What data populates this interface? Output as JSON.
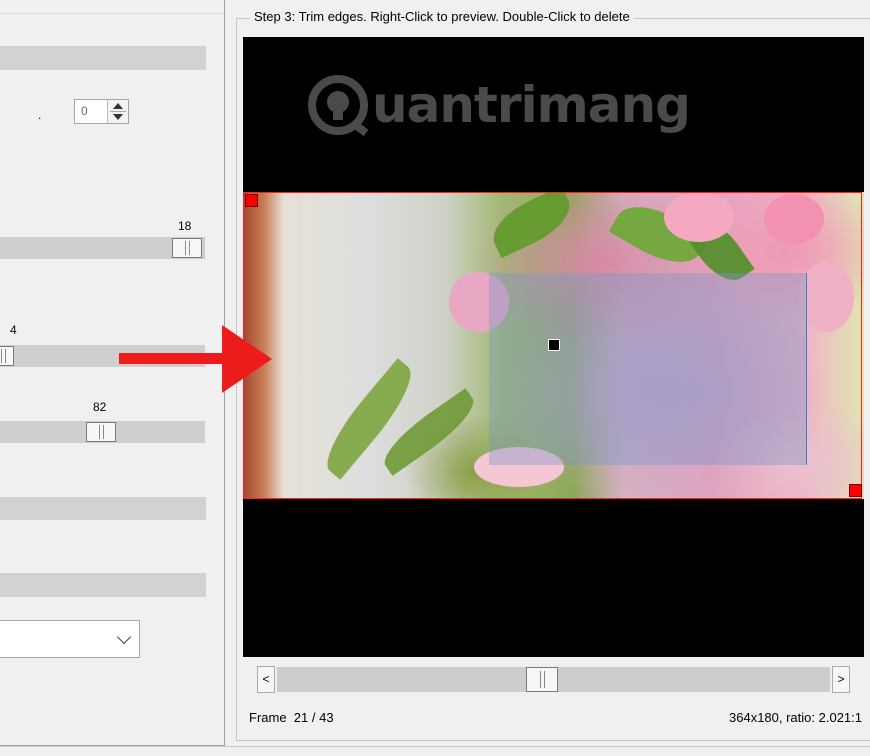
{
  "left": {
    "spin_value": "0",
    "spin_dot": ".",
    "slider1_value": "18",
    "slider2_value": "4",
    "slider3_value": "82"
  },
  "group": {
    "title": "Step 3: Trim edges. Right-Click to preview. Double-Click to delete"
  },
  "preview": {
    "watermark": "uantrimang"
  },
  "scroll": {
    "left_label": "<",
    "right_label": ">"
  },
  "status": {
    "frame_label": "Frame",
    "frame_current": "21",
    "frame_total": "43",
    "size_info": "364x180, ratio: 2.021:1"
  },
  "colors": {
    "crop_border": "#ff2020",
    "arrow": "#ec1c1c",
    "selection_edge": "#3a7fd0"
  }
}
